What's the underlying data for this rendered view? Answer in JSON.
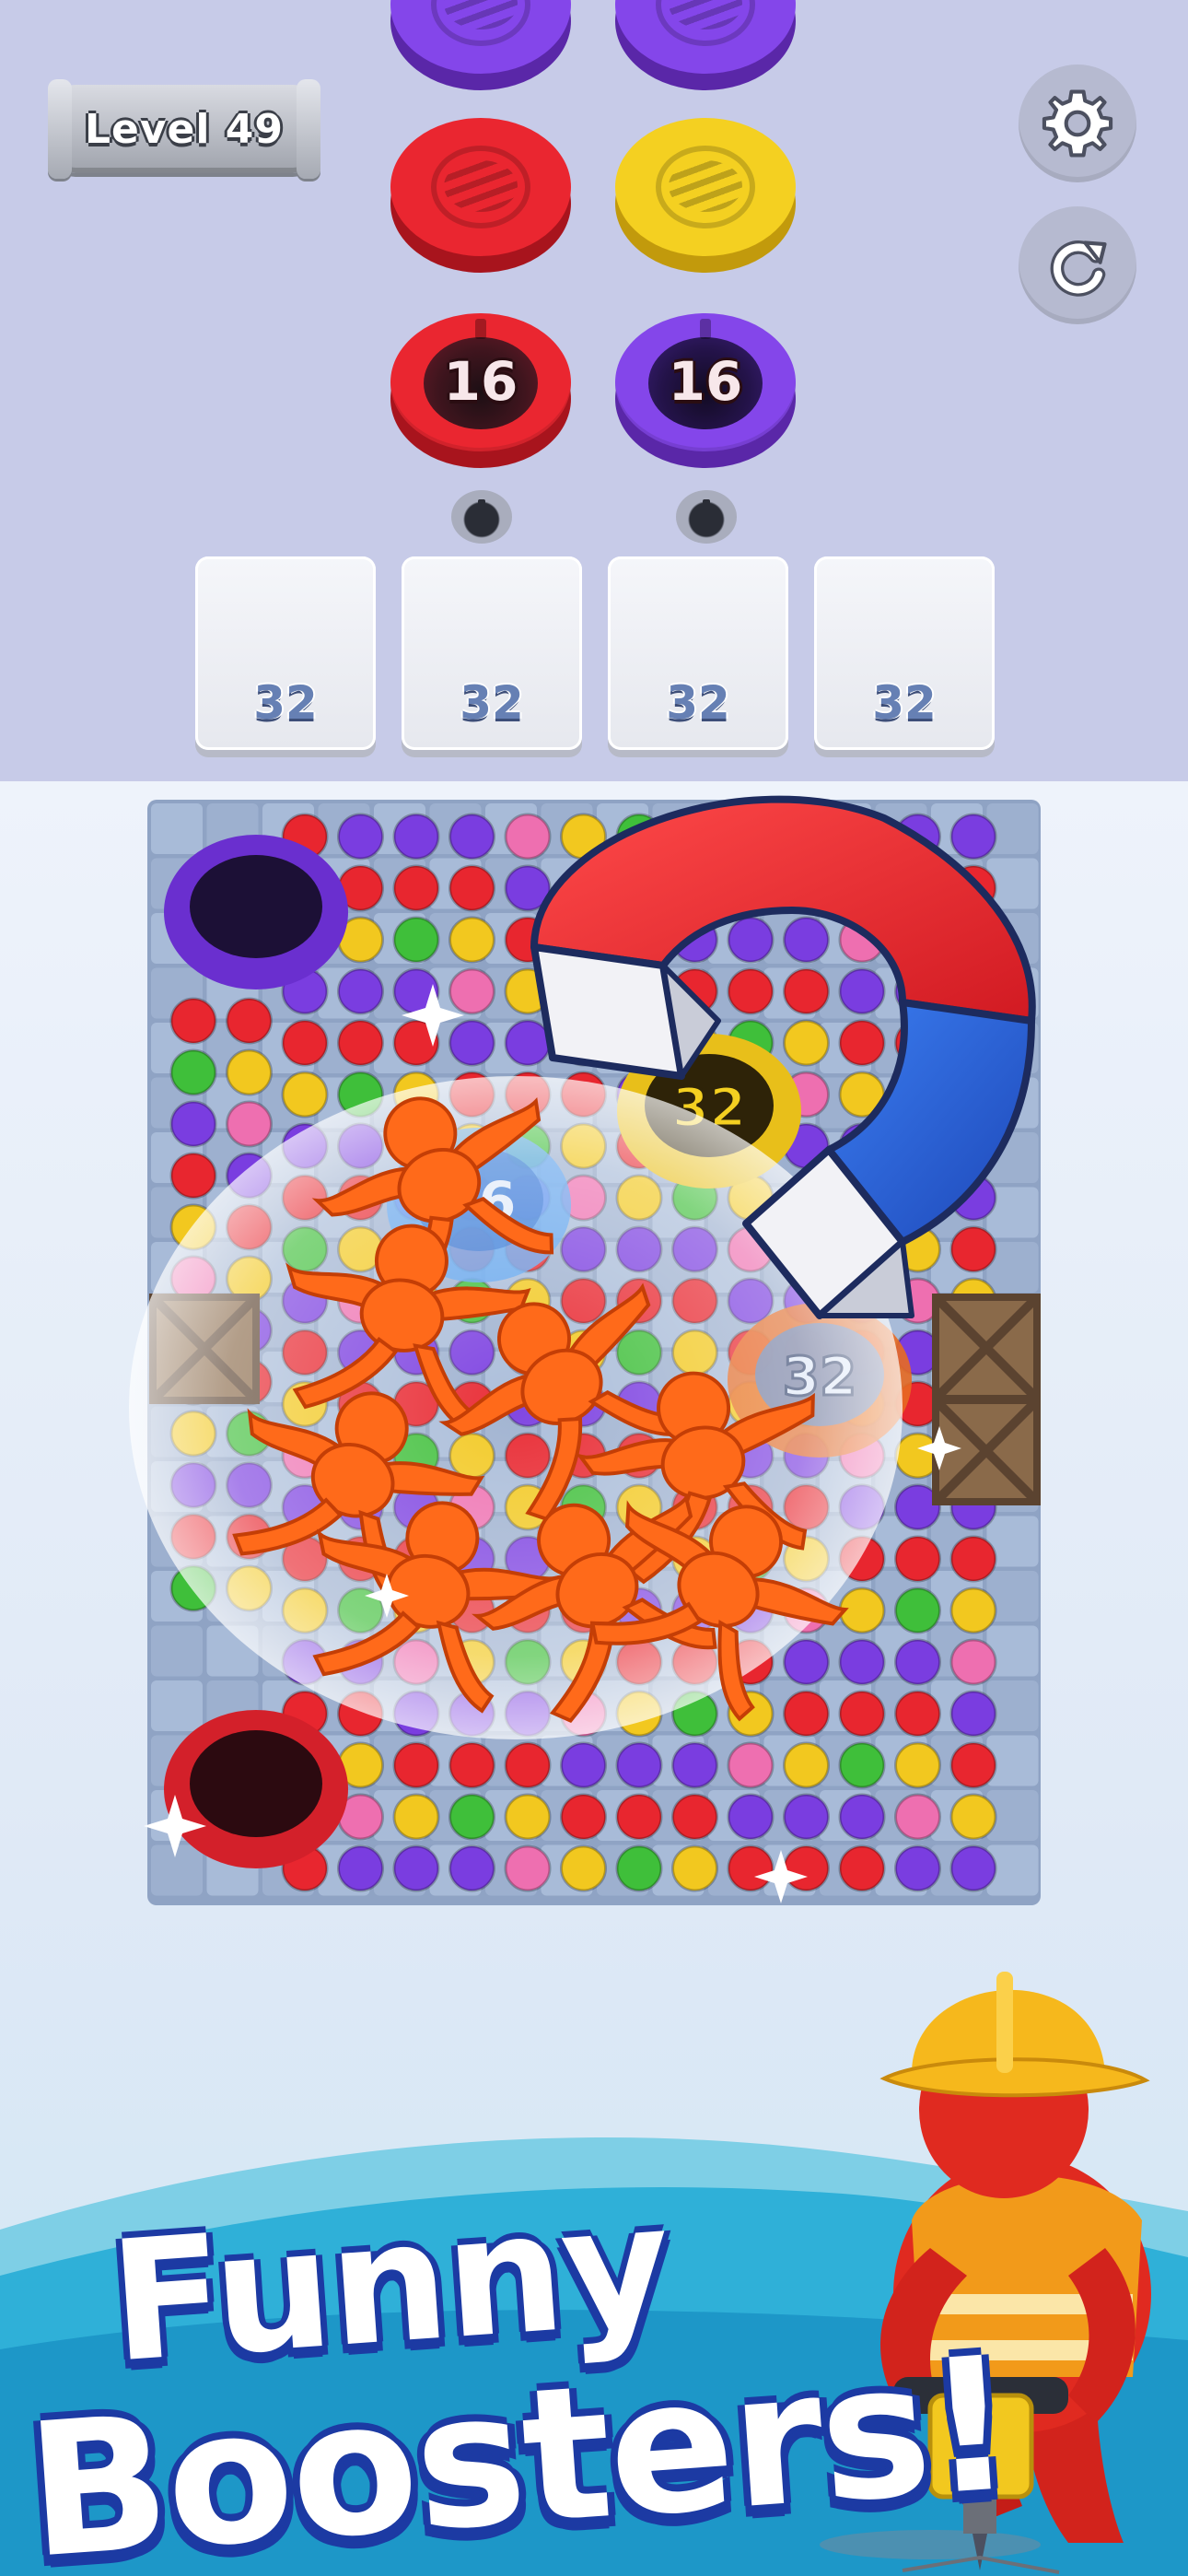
{
  "hud": {
    "level_label": "Level 49",
    "settings_icon": "gear-icon",
    "restart_icon": "restart-icon"
  },
  "color_stacks": [
    {
      "lids": [
        "purple",
        "red"
      ],
      "cap_color": "red",
      "cap_count": "16"
    },
    {
      "lids": [
        "purple",
        "yellow"
      ],
      "cap_color": "purple",
      "cap_count": "16"
    }
  ],
  "slots": [
    {
      "count": "32"
    },
    {
      "count": "32"
    },
    {
      "count": "32"
    },
    {
      "count": "32"
    }
  ],
  "board": {
    "holes": [
      {
        "color": "purple",
        "count": ""
      },
      {
        "color": "red",
        "count": ""
      },
      {
        "color": "blue",
        "count": "6"
      },
      {
        "color": "yellow",
        "count": "32"
      },
      {
        "color": "orange",
        "count": "32"
      }
    ],
    "booster": "magnet-icon"
  },
  "colors": {
    "red": "#e8262f",
    "purple": "#7a3de0",
    "yellow": "#f2c81f",
    "green": "#3fbf3a",
    "blue": "#3f86e8",
    "orange": "#f06a1a",
    "pink": "#ee6fb0"
  },
  "promo": {
    "line1": "Funny",
    "line2": "Boosters!"
  }
}
